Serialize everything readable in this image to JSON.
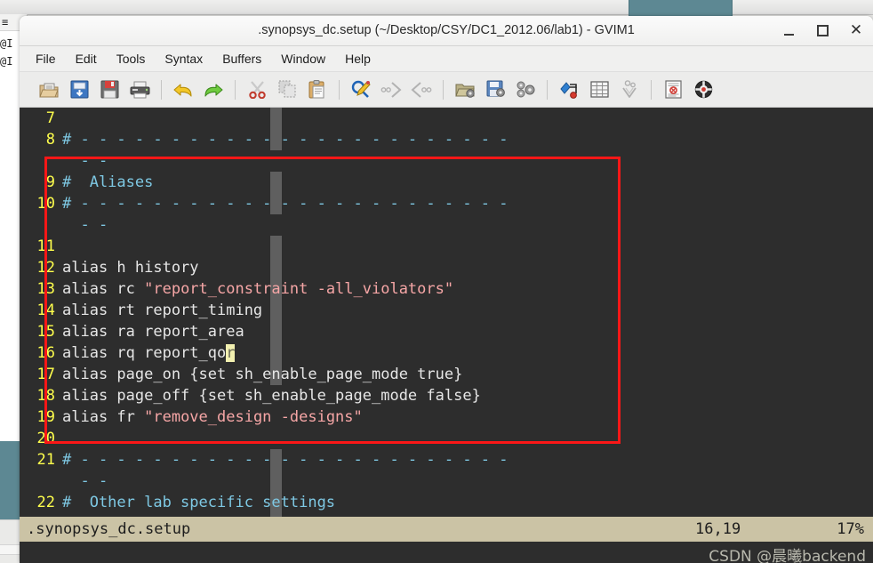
{
  "window": {
    "title": ".synopsys_dc.setup (~/Desktop/CSY/DC1_2012.06/lab1) - GVIM1",
    "minimize_label": "",
    "maximize_label": "",
    "close_label": "✕"
  },
  "background": {
    "terminal_line_1": "@I",
    "terminal_line_2": "@I",
    "terminal_line_0": "≡"
  },
  "menubar": {
    "items": [
      {
        "label": "File",
        "name": "menu-file"
      },
      {
        "label": "Edit",
        "name": "menu-edit"
      },
      {
        "label": "Tools",
        "name": "menu-tools"
      },
      {
        "label": "Syntax",
        "name": "menu-syntax"
      },
      {
        "label": "Buffers",
        "name": "menu-buffers"
      },
      {
        "label": "Window",
        "name": "menu-window"
      },
      {
        "label": "Help",
        "name": "menu-help"
      }
    ]
  },
  "toolbar": {
    "buttons": [
      {
        "icon": "open-folder-icon",
        "title": "Open"
      },
      {
        "icon": "save-icon",
        "title": "Save"
      },
      {
        "icon": "save-floppy-icon",
        "title": "Save All"
      },
      {
        "icon": "print-icon",
        "title": "Print"
      },
      {
        "separator": true
      },
      {
        "icon": "undo-arrow-icon",
        "title": "Undo"
      },
      {
        "icon": "redo-arrow-icon",
        "title": "Redo"
      },
      {
        "separator": true
      },
      {
        "icon": "scissors-cut-icon",
        "title": "Cut"
      },
      {
        "icon": "copy-icon",
        "title": "Copy"
      },
      {
        "icon": "clipboard-paste-icon",
        "title": "Paste"
      },
      {
        "separator": true
      },
      {
        "icon": "find-magnifier-icon",
        "title": "Find"
      },
      {
        "icon": "find-next-icon",
        "title": "Find Next"
      },
      {
        "icon": "find-prev-icon",
        "title": "Find Previous"
      },
      {
        "separator": true
      },
      {
        "icon": "load-session-icon",
        "title": "Load Session"
      },
      {
        "icon": "save-session-icon",
        "title": "Save Session"
      },
      {
        "icon": "run-script-icon",
        "title": "Run Script"
      },
      {
        "separator": true
      },
      {
        "icon": "make-build-icon",
        "title": "Make"
      },
      {
        "icon": "shell-grid-icon",
        "title": "Shell"
      },
      {
        "icon": "make-tags-icon",
        "title": "Make Tags"
      },
      {
        "separator": true
      },
      {
        "icon": "help-book-icon",
        "title": "Help"
      },
      {
        "icon": "help-lifebuoy-icon",
        "title": "Find Help"
      }
    ]
  },
  "editor": {
    "lines": [
      {
        "no": "7",
        "segments": []
      },
      {
        "no": "8",
        "segments": [
          {
            "cls": "tok-comment",
            "text": "# - - - - - - - - - - - - - - - - - - - - - - - -"
          }
        ]
      },
      {
        "no": "",
        "segments": [
          {
            "cls": "tok-comment",
            "text": "  - -"
          }
        ]
      },
      {
        "no": "9",
        "segments": [
          {
            "cls": "tok-comment",
            "text": "#  Aliases"
          }
        ]
      },
      {
        "no": "10",
        "segments": [
          {
            "cls": "tok-comment",
            "text": "# - - - - - - - - - - - - - - - - - - - - - - - -"
          }
        ]
      },
      {
        "no": "",
        "segments": [
          {
            "cls": "tok-comment",
            "text": "  - -"
          }
        ]
      },
      {
        "no": "11",
        "segments": []
      },
      {
        "no": "12",
        "segments": [
          {
            "cls": "tok-plain",
            "text": "alias h history"
          }
        ]
      },
      {
        "no": "13",
        "segments": [
          {
            "cls": "tok-plain",
            "text": "alias rc "
          },
          {
            "cls": "tok-string",
            "text": "\"report_constraint -all_violators\""
          }
        ]
      },
      {
        "no": "14",
        "segments": [
          {
            "cls": "tok-plain",
            "text": "alias rt report_timing"
          }
        ]
      },
      {
        "no": "15",
        "segments": [
          {
            "cls": "tok-plain",
            "text": "alias ra report_area"
          }
        ]
      },
      {
        "no": "16",
        "segments": [
          {
            "cls": "tok-plain",
            "text": "alias rq report_qo"
          },
          {
            "cls": "cursor-block",
            "text": "r"
          }
        ]
      },
      {
        "no": "17",
        "segments": [
          {
            "cls": "tok-plain",
            "text": "alias page_on {set sh_enable_page_mode true}"
          }
        ]
      },
      {
        "no": "18",
        "segments": [
          {
            "cls": "tok-plain",
            "text": "alias page_off {set sh_enable_page_mode false}"
          }
        ]
      },
      {
        "no": "19",
        "segments": [
          {
            "cls": "tok-plain",
            "text": "alias fr "
          },
          {
            "cls": "tok-string",
            "text": "\"remove_design -designs\""
          }
        ]
      },
      {
        "no": "20",
        "segments": []
      },
      {
        "no": "21",
        "segments": [
          {
            "cls": "tok-comment",
            "text": "# - - - - - - - - - - - - - - - - - - - - - - - -"
          }
        ]
      },
      {
        "no": "",
        "segments": [
          {
            "cls": "tok-comment",
            "text": "  - -"
          }
        ]
      },
      {
        "no": "22",
        "segments": [
          {
            "cls": "tok-comment",
            "text": "#  Other lab specific settings"
          }
        ]
      }
    ],
    "annotation": {
      "color": "#fb1717",
      "shape": "rectangle"
    }
  },
  "statusline": {
    "filename": ".synopsys_dc.setup",
    "position": "16,19",
    "percent": "17%"
  },
  "watermark": {
    "text": "CSDN @晨曦backend"
  }
}
